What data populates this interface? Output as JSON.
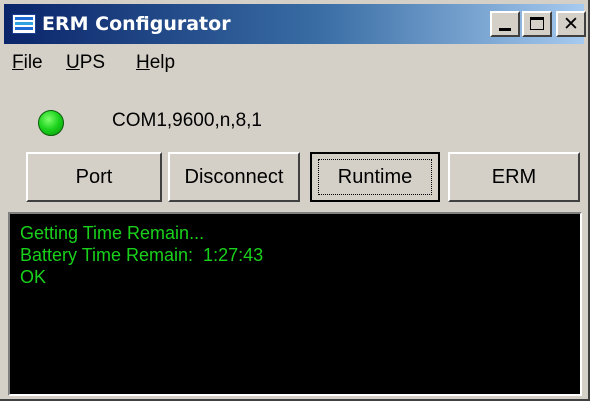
{
  "window": {
    "title": "ERM Configurator",
    "icon": "app-icon",
    "controls": [
      "minimize-icon",
      "maximize-icon",
      "close-icon"
    ],
    "close_glyph": "✕"
  },
  "menu": {
    "items": [
      {
        "accel": "F",
        "rest": "ile"
      },
      {
        "accel": "U",
        "rest": "PS"
      },
      {
        "accel": "H",
        "rest": "elp"
      }
    ]
  },
  "status": {
    "led_color": "#19d11b",
    "port_settings": "COM1,9600,n,8,1"
  },
  "buttons": {
    "port": "Port",
    "disconnect": "Disconnect",
    "runtime": "Runtime",
    "erm": "ERM"
  },
  "console": {
    "text_color": "#19d11b",
    "background": "#000000",
    "lines": [
      "Getting Time Remain...",
      "Battery Time Remain:  1:27:43",
      "OK"
    ]
  }
}
